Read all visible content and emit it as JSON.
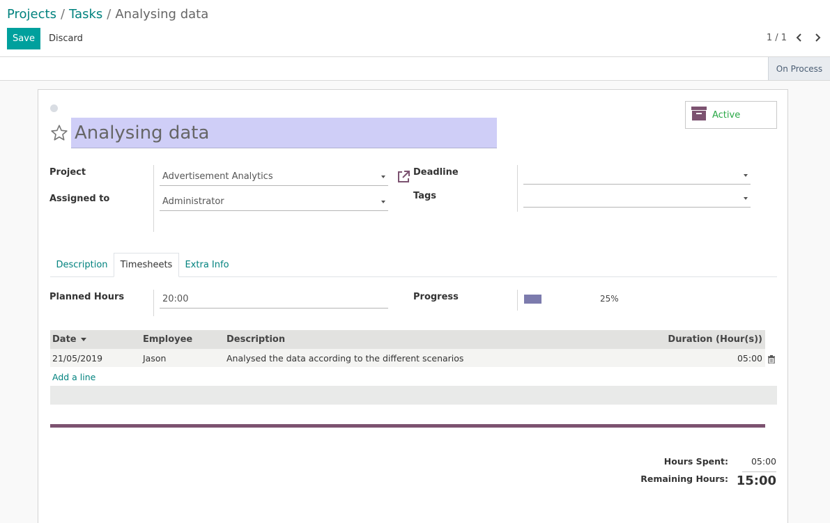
{
  "breadcrumb": {
    "items": [
      "Projects",
      "Tasks",
      "Analysing data"
    ],
    "separator": "/"
  },
  "toolbar": {
    "save_label": "Save",
    "discard_label": "Discard"
  },
  "pager": {
    "value": "1 / 1"
  },
  "statusbar": {
    "stage": "On Process"
  },
  "task": {
    "title": "Analysing data",
    "active_label": "Active",
    "fields": {
      "project_label": "Project",
      "project_value": "Advertisement Analytics",
      "assigned_label": "Assigned to",
      "assigned_value": "Administrator",
      "deadline_label": "Deadline",
      "deadline_value": "",
      "tags_label": "Tags",
      "tags_value": ""
    }
  },
  "tabs": [
    {
      "label": "Description",
      "active": false
    },
    {
      "label": "Timesheets",
      "active": true
    },
    {
      "label": "Extra Info",
      "active": false
    }
  ],
  "timesheets": {
    "planned_hours_label": "Planned Hours",
    "planned_hours_value": "20:00",
    "progress_label": "Progress",
    "progress_value": "25%",
    "progress_fraction": 0.25,
    "columns": [
      "Date",
      "Employee",
      "Description",
      "Duration (Hour(s))"
    ],
    "rows": [
      {
        "date": "21/05/2019",
        "employee": "Jason",
        "description": "Analysed the data according to the different scenarios",
        "duration": "05:00"
      }
    ],
    "add_line_label": "Add a line",
    "hours_spent_label": "Hours Spent:",
    "hours_spent_value": "05:00",
    "remaining_label": "Remaining Hours:",
    "remaining_value": "15:00"
  },
  "colors": {
    "accent": "#00a09d",
    "link": "#00827e",
    "title_highlight": "#cfcef7",
    "progress": "#7c7bad",
    "active_green": "#28a745",
    "rule_purple": "#7c5270"
  }
}
